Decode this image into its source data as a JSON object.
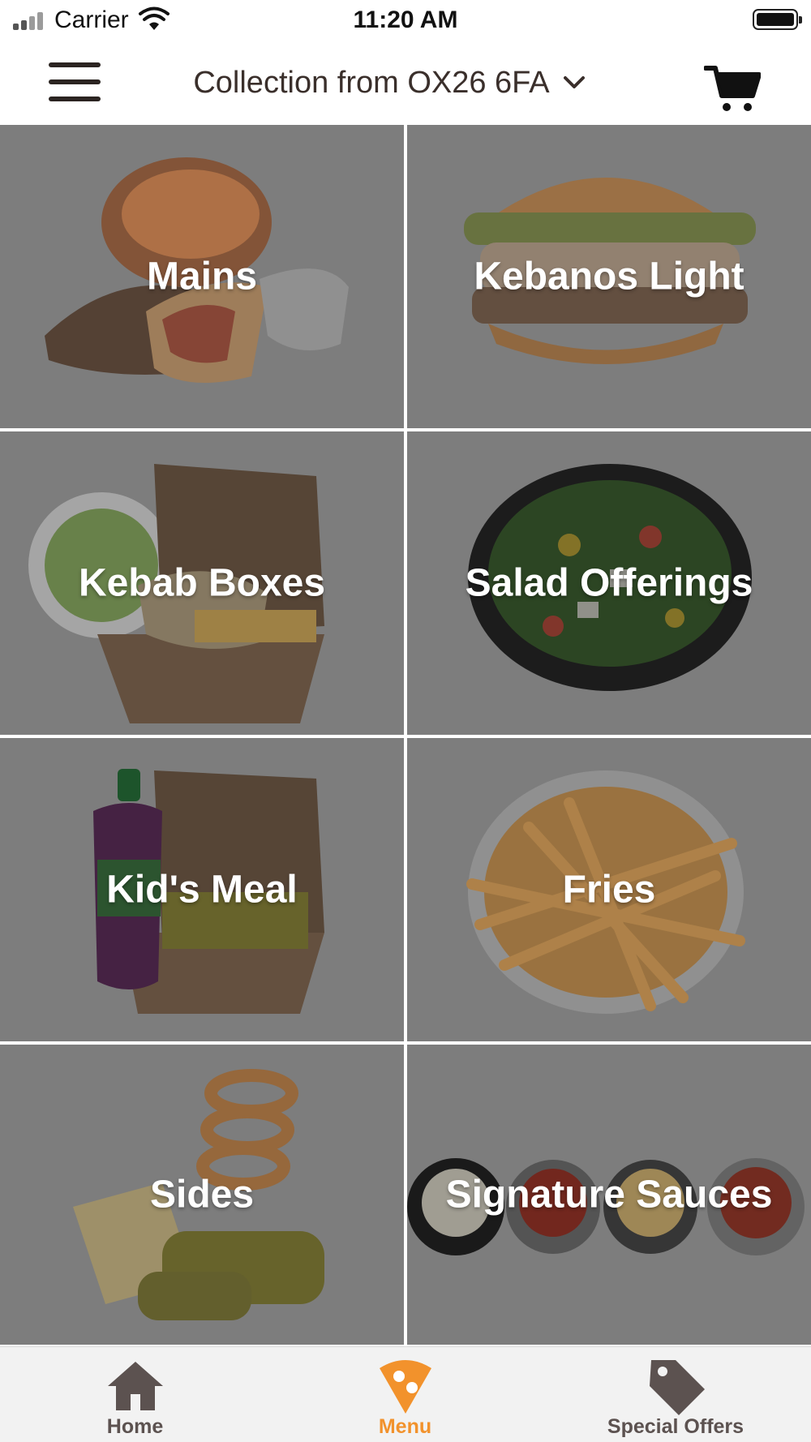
{
  "status_bar": {
    "carrier": "Carrier",
    "time": "11:20 AM",
    "icons": [
      "signal-icon",
      "wifi-icon",
      "battery-icon"
    ]
  },
  "header": {
    "menu_icon": "hamburger-menu-icon",
    "location_label": "Collection from OX26 6FA",
    "location_icon": "chevron-down-icon",
    "cart_icon": "cart-icon"
  },
  "menu_categories": [
    {
      "label": "Mains",
      "image": "wraps-and-kebabs"
    },
    {
      "label": "Kebanos Light",
      "image": "burger"
    },
    {
      "label": "Kebab Boxes",
      "image": "kebab-box-with-salad"
    },
    {
      "label": "Salad Offerings",
      "image": "salad-bowl"
    },
    {
      "label": "Kid's Meal",
      "image": "drink-bottle-and-nugget-box"
    },
    {
      "label": "Fries",
      "image": "bowl-of-fries"
    },
    {
      "label": "Sides",
      "image": "onion-rings-and-nuggets"
    },
    {
      "label": "Signature Sauces",
      "image": "sauce-pots"
    }
  ],
  "tab_bar": {
    "tabs": [
      {
        "label": "Home",
        "icon": "home-icon",
        "active": false
      },
      {
        "label": "Menu",
        "icon": "menu-pin-icon",
        "active": true
      },
      {
        "label": "Special Offers",
        "icon": "tag-icon",
        "active": false
      }
    ]
  },
  "colors": {
    "accent": "#f2922c",
    "tab_inactive": "#5c5250",
    "header_text": "#3a2f2b",
    "tile_overlay": "#858585"
  }
}
